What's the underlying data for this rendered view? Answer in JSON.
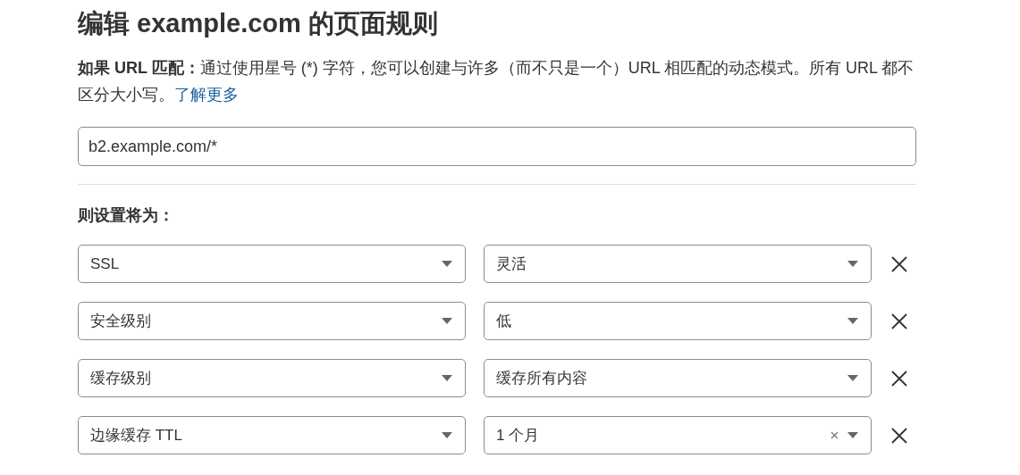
{
  "title": "编辑 example.com 的页面规则",
  "description": {
    "text": "**如果 URL 匹配：**通过使用星号 (*) 字符，您可以创建与许多（而不只是一个）URL 相匹配的动态模式。所有 URL 都不区分大小写。",
    "link": "了解更多"
  },
  "url_field": {
    "value": "b2.example.com/*"
  },
  "settings_heading": "则设置将为：",
  "settings": [
    {
      "setting": "SSL",
      "value": "灵活",
      "clearable": false
    },
    {
      "setting": "安全级别",
      "value": "低",
      "clearable": false
    },
    {
      "setting": "缓存级别",
      "value": "缓存所有内容",
      "clearable": false
    },
    {
      "setting": "边缘缓存 TTL",
      "value": "1 个月",
      "clearable": true
    }
  ]
}
